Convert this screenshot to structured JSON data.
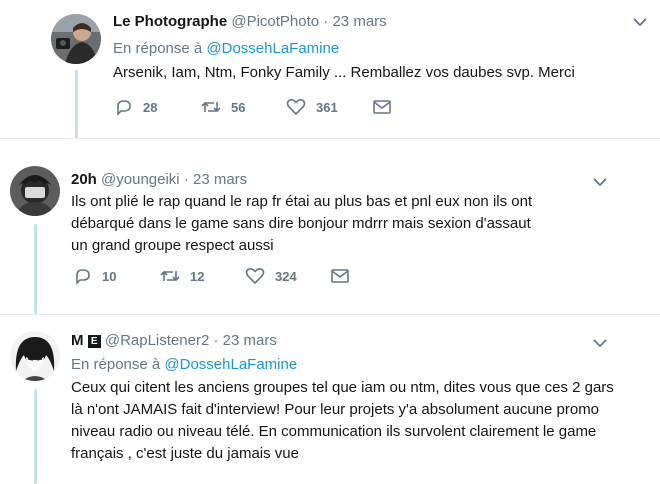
{
  "tweets": [
    {
      "name": "Le Photographe",
      "handle": "@PicotPhoto",
      "sep": "·",
      "time": "23 mars",
      "reply_prefix": "En réponse à ",
      "reply_mention": "@DossehLaFamine",
      "text": "Arsenik, Iam, Ntm, Fonky Family ... Remballez vos daubes svp. Merci",
      "replies": "28",
      "retweets": "56",
      "likes": "361"
    },
    {
      "name": "20h",
      "handle": "@youngeiki",
      "sep": "·",
      "time": "23 mars",
      "text": "Ils ont plié le rap quand le rap fr étai au plus bas et pnl eux non ils ont débarqué dans le game sans dire bonjour mdrrr mais sexion d'assaut un grand groupe respect aussi",
      "replies": "10",
      "retweets": "12",
      "likes": "324"
    },
    {
      "name": "M",
      "badge": "E",
      "handle": "@RapListener2",
      "sep": "·",
      "time": "23 mars",
      "reply_prefix": "En réponse à ",
      "reply_mention": "@DossehLaFamine",
      "text": "Ceux qui citent les anciens groupes tel que iam ou ntm, dites vous que ces 2 gars là n'ont JAMAIS fait d'interview! Pour leur projets y'a absolument aucune promo niveau radio ou niveau télé. En communication ils survolent clairement le game français , c'est juste du jamais vue"
    }
  ],
  "colors": {
    "text": "#14171a",
    "secondary": "#657786",
    "link": "#1b95e0",
    "thread": "#bfe2ee",
    "divider": "#e6ecf0"
  },
  "icons": [
    "reply-icon",
    "retweet-icon",
    "like-icon",
    "message-icon",
    "chevron-down-icon"
  ]
}
